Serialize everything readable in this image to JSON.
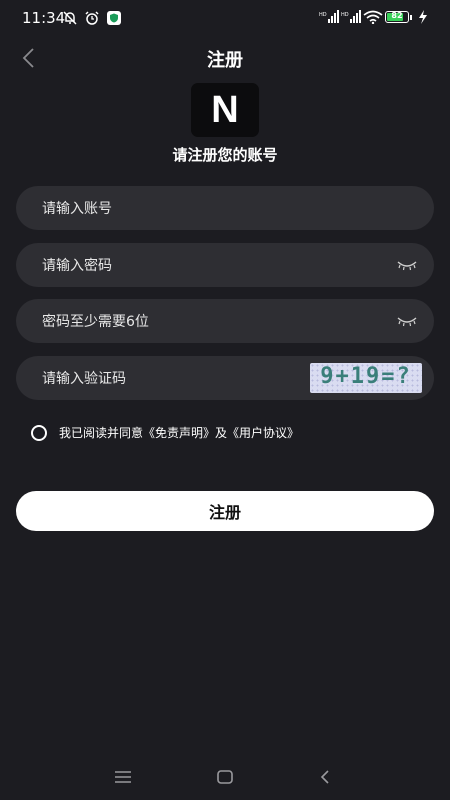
{
  "status_bar": {
    "time": "11:34",
    "battery_level": "82",
    "battery_color": "#3ad15a",
    "left_icons": [
      "muted-bell-icon",
      "alarm-icon",
      "shield-app-icon"
    ],
    "right_icons": [
      "hd-signal-icon",
      "hd-signal-icon",
      "wifi-icon",
      "battery-icon",
      "charging-icon"
    ]
  },
  "header": {
    "title": "注册",
    "back_icon": "chevron-left-icon"
  },
  "logo": {
    "letter": "N"
  },
  "subtitle": "请注册您的账号",
  "form": {
    "account_placeholder": "请输入账号",
    "password_placeholder": "请输入密码",
    "password_min_placeholder": "密码至少需要6位",
    "captcha_placeholder": "请输入验证码",
    "captcha_text": "9+19=?",
    "eye_icon": "eye-closed-icon"
  },
  "agreement": {
    "prefix": "我已阅读并同意",
    "disclaimer_link": "《免责声明》",
    "connector": "及",
    "user_agreement_link": "《用户协议》"
  },
  "register_button_label": "注册",
  "system_nav": {
    "icons": [
      "menu-icon",
      "home-icon",
      "back-icon"
    ]
  },
  "colors": {
    "background": "#1c1c21",
    "field_background": "#2e2e33",
    "button_background": "#ffffff"
  }
}
